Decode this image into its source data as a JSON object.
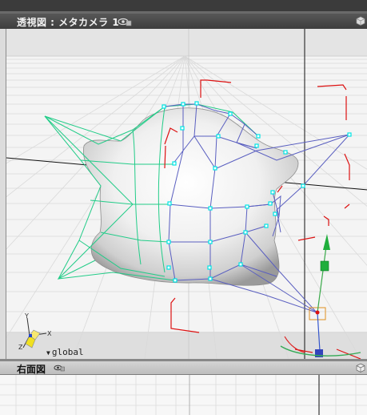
{
  "perspective_view": {
    "title": "透視図 : メタカメラ 1",
    "coordinate_label": "global",
    "axis_labels": {
      "y": "Y",
      "x": "X",
      "z": "Z"
    }
  },
  "right_view": {
    "title": "右面図"
  },
  "icons": {
    "eye": "eye-icon",
    "cube": "view-cube-icon"
  },
  "colors": {
    "cage": "#22cc88",
    "grid_lines": "#5a5fc0",
    "vertex": "#00e5e5",
    "selection": "#dd1111",
    "title_bg": "#444444"
  }
}
